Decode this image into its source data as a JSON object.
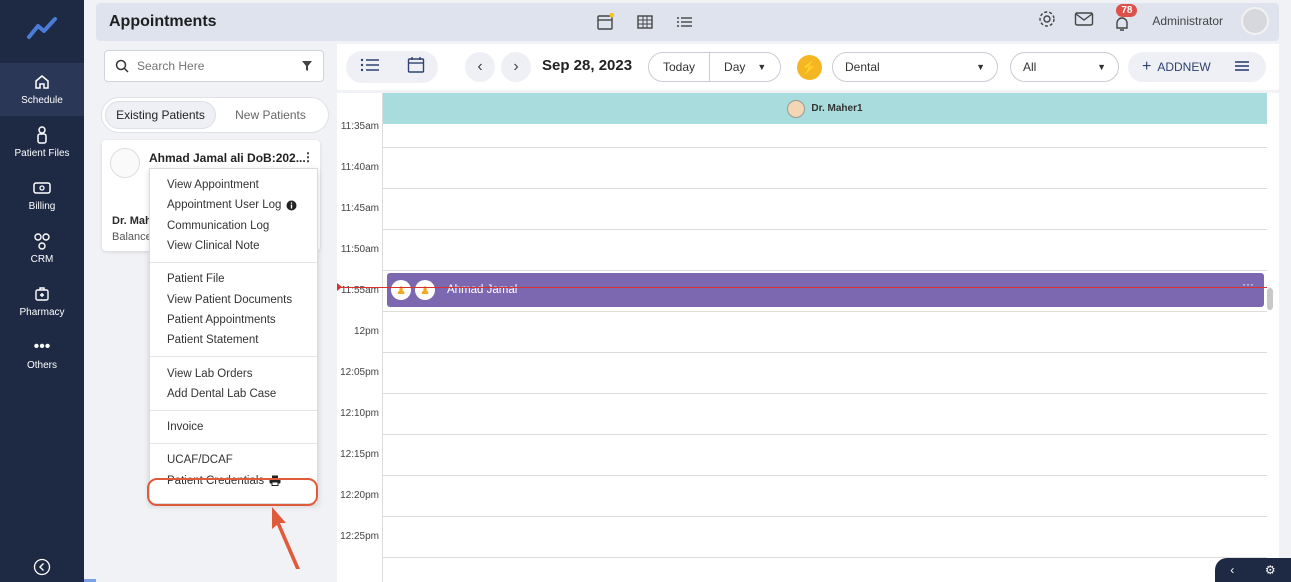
{
  "sidebar": {
    "items": [
      {
        "label": "Schedule",
        "icon": "home-icon"
      },
      {
        "label": "Patient Files",
        "icon": "person-icon"
      },
      {
        "label": "Billing",
        "icon": "money-icon"
      },
      {
        "label": "CRM",
        "icon": "network-icon"
      },
      {
        "label": "Pharmacy",
        "icon": "medkit-icon"
      },
      {
        "label": "Others",
        "icon": "more-icon"
      }
    ]
  },
  "header": {
    "title": "Appointments",
    "notification_count": "78",
    "user_name": "Administrator"
  },
  "left_panel": {
    "search_placeholder": "Search Here",
    "tabs": [
      "Existing Patients",
      "New Patients"
    ],
    "patient": {
      "name": "Ahmad Jamal ali DoB:202...",
      "doctor": "Dr. Mah",
      "balance": "Balance"
    }
  },
  "context_menu": {
    "groups": [
      [
        "View Appointment",
        "Appointment User Log",
        "Communication Log",
        "View Clinical Note"
      ],
      [
        "Patient File",
        "View Patient Documents",
        "Patient Appointments",
        "Patient Statement"
      ],
      [
        "View Lab Orders",
        "Add Dental Lab Case"
      ],
      [
        "Invoice"
      ],
      [
        "UCAF/DCAF",
        "Patient Credentials"
      ]
    ]
  },
  "toolbar": {
    "date": "Sep 28, 2023",
    "today_label": "Today",
    "view_label": "Day",
    "specialty": "Dental",
    "filter": "All",
    "addnew_label": "ADDNEW"
  },
  "calendar": {
    "doctor": "Dr. Maher1",
    "times": [
      "11:35am",
      "11:40am",
      "11:45am",
      "11:50am",
      "11:55am",
      "12pm",
      "12:05pm",
      "12:10pm",
      "12:15pm",
      "12:20pm",
      "12:25pm"
    ],
    "appointment": {
      "name": "Ahmad Jamal",
      "time": "11:55am"
    }
  },
  "colors": {
    "sidebar": "#1e2a44",
    "appointment": "#7b68b0",
    "doctor_header": "#a9dcdc",
    "highlight": "#e05a3c",
    "badge": "#e0504a"
  }
}
